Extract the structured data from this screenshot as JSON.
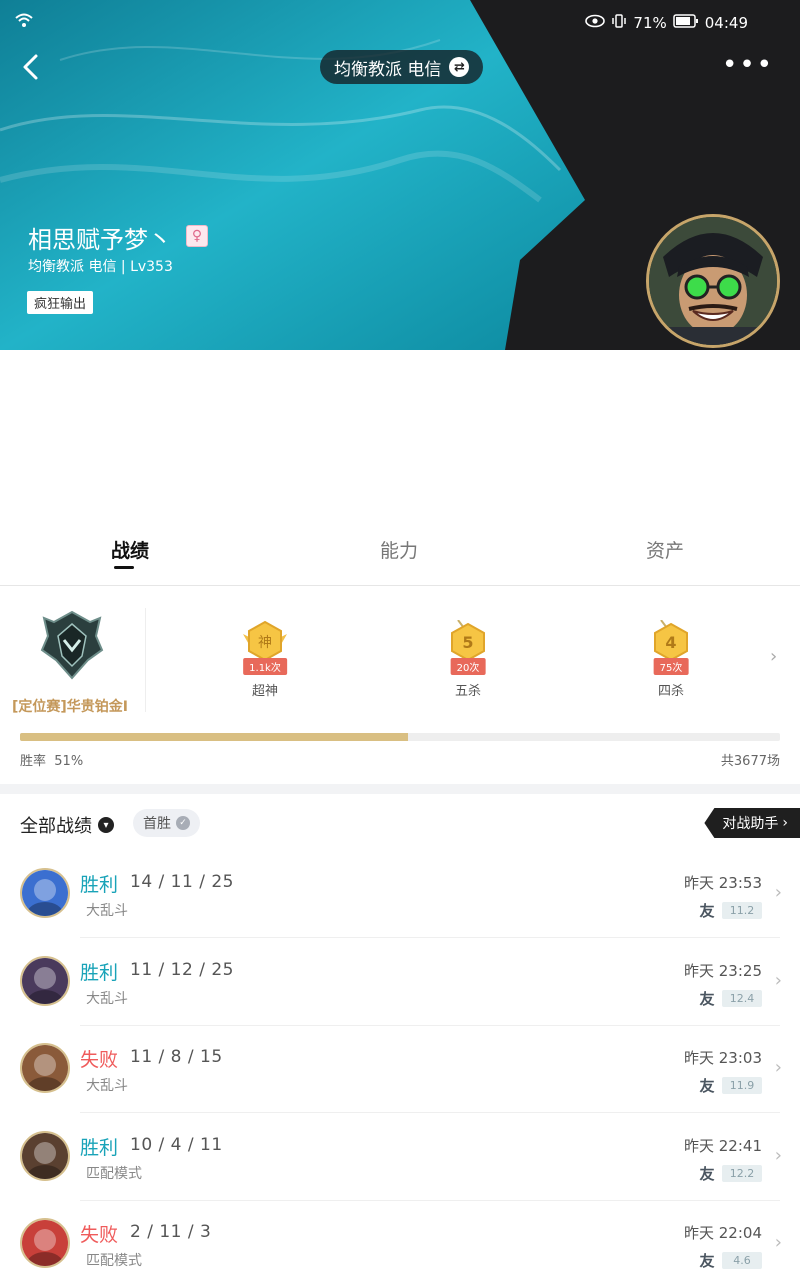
{
  "status_bar": {
    "battery": "71%",
    "time": "04:49"
  },
  "header": {
    "server": "均衡教派 电信",
    "player_name": "相思赋予梦丶",
    "sub_info": "均衡教派 电信 | Lv353",
    "tag": "疯狂输出"
  },
  "tabs": [
    {
      "label": "战绩",
      "active": true
    },
    {
      "label": "能力",
      "active": false
    },
    {
      "label": "资产",
      "active": false
    }
  ],
  "rank": {
    "label": "[定位赛]华贵铂金I",
    "honors": [
      {
        "glyph": "神",
        "count": "1.1k次",
        "label": "超神"
      },
      {
        "glyph": "5",
        "count": "20次",
        "label": "五杀"
      },
      {
        "glyph": "4",
        "count": "75次",
        "label": "四杀"
      }
    ],
    "win_rate_label": "胜率",
    "win_rate_value": "51%",
    "win_rate_fraction": 0.51,
    "total_games": "共3677场"
  },
  "filter": {
    "all_label": "全部战绩",
    "first_win": "首胜",
    "assistant": "对战助手"
  },
  "matches": [
    {
      "result": "胜利",
      "outcome": "win",
      "kda": "14 / 11 / 25",
      "mode": "大乱斗",
      "time": "昨天 23:53",
      "friend": "友",
      "grade": "11.2",
      "hero_color": "#3b6fd0"
    },
    {
      "result": "胜利",
      "outcome": "win",
      "kda": "11 / 12 / 25",
      "mode": "大乱斗",
      "time": "昨天 23:25",
      "friend": "友",
      "grade": "12.4",
      "hero_color": "#4a3a5c"
    },
    {
      "result": "失败",
      "outcome": "loss",
      "kda": "11 / 8 / 15",
      "mode": "大乱斗",
      "time": "昨天 23:03",
      "friend": "友",
      "grade": "11.9",
      "hero_color": "#8a5a3a"
    },
    {
      "result": "胜利",
      "outcome": "win",
      "kda": "10 / 4 / 11",
      "mode": "匹配模式",
      "time": "昨天 22:41",
      "friend": "友",
      "grade": "12.2",
      "hero_color": "#5a4030"
    },
    {
      "result": "失败",
      "outcome": "loss",
      "kda": "2 / 11 / 3",
      "mode": "匹配模式",
      "time": "昨天 22:04",
      "friend": "友",
      "grade": "4.6",
      "hero_color": "#c8403a"
    }
  ]
}
